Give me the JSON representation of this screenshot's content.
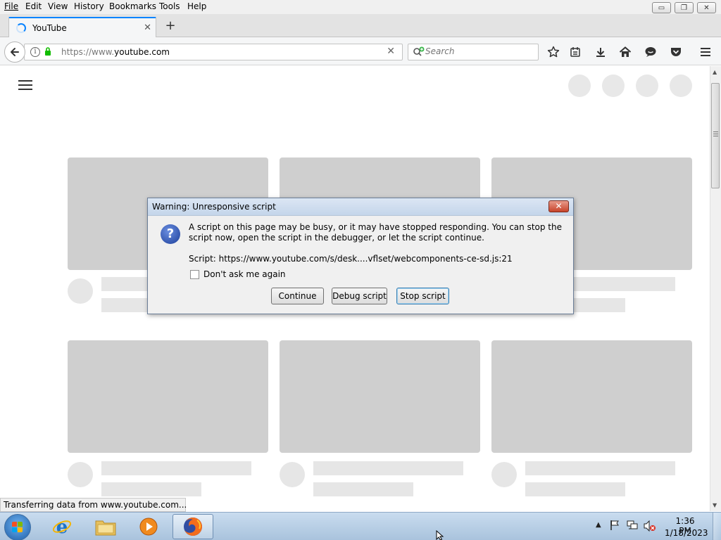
{
  "menubar": {
    "items": [
      {
        "label": "File"
      },
      {
        "label": "Edit"
      },
      {
        "label": "View"
      },
      {
        "label": "History"
      },
      {
        "label": "Bookmarks"
      },
      {
        "label": "Tools"
      },
      {
        "label": "Help"
      }
    ]
  },
  "window_controls": {
    "minimize": "▭",
    "restore": "❐",
    "close": "✕"
  },
  "tabs": [
    {
      "title": "YouTube",
      "loading": true
    }
  ],
  "navbar": {
    "url_prefix": "https://www.",
    "url_domain": "youtube.com",
    "search_placeholder": "Search"
  },
  "page": {
    "thumbnail_color": "#cfcfcf",
    "placeholder_color": "#e6e6e6"
  },
  "status_text": "Transferring data from www.youtube.com...",
  "dialog": {
    "title": "Warning: Unresponsive script",
    "message": "A script on this page may be busy, or it may have stopped responding. You can stop the script now, open the script in the debugger, or let the script continue.",
    "script_line": "Script: https://www.youtube.com/s/desk....vflset/webcomponents-ce-sd.js:21",
    "checkbox_label": "Don't ask me again",
    "checkbox_checked": false,
    "buttons": {
      "continue": "Continue",
      "debug": "Debug script",
      "stop": "Stop script"
    }
  },
  "taskbar": {
    "apps": [
      "internet-explorer",
      "windows-explorer",
      "media-player",
      "firefox"
    ],
    "active_app": "firefox",
    "clock_time": "1:36 PM",
    "clock_date": "1/18/2023"
  },
  "colors": {
    "tab_accent": "#0a84ff",
    "lock_green": "#12bc00",
    "dialog_close_red": "#c7432a"
  }
}
